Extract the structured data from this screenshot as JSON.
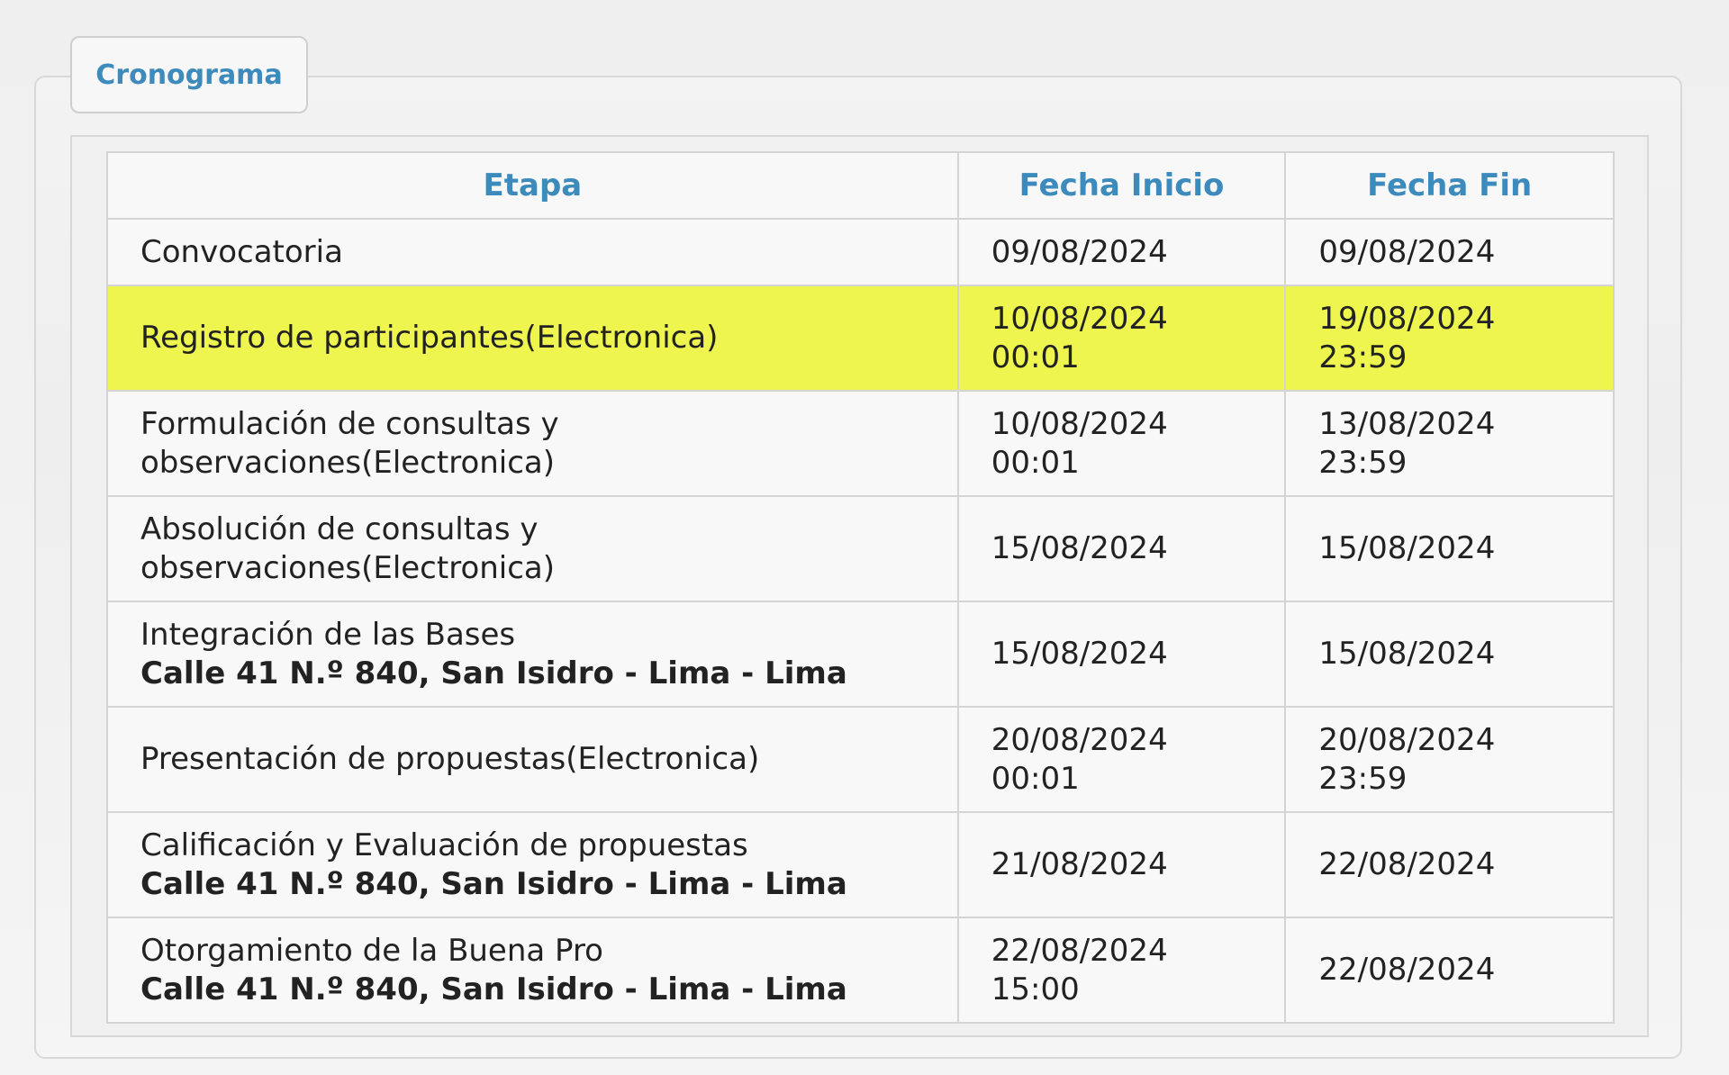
{
  "tab": {
    "label": "Cronograma"
  },
  "table": {
    "headers": {
      "etapa": "Etapa",
      "inicio": "Fecha Inicio",
      "fin": "Fecha Fin"
    },
    "rows": [
      {
        "etapa": "Convocatoria",
        "address": "",
        "inicio_date": "09/08/2024",
        "inicio_time": "",
        "fin_date": "09/08/2024",
        "fin_time": ""
      },
      {
        "etapa": "Registro de participantes(Electronica)",
        "address": "",
        "inicio_date": "10/08/2024",
        "inicio_time": "00:01",
        "fin_date": "19/08/2024",
        "fin_time": "23:59"
      },
      {
        "etapa_l1": "Formulación de consultas y",
        "etapa_l2": "observaciones(Electronica)",
        "inicio_date": "10/08/2024",
        "inicio_time": "00:01",
        "fin_date": "13/08/2024",
        "fin_time": "23:59"
      },
      {
        "etapa_l1": "Absolución de consultas y",
        "etapa_l2": "observaciones(Electronica)",
        "inicio_date": "15/08/2024",
        "inicio_time": "",
        "fin_date": "15/08/2024",
        "fin_time": ""
      },
      {
        "etapa": "Integración de las Bases",
        "address": "Calle 41 N.º 840, San Isidro - Lima - Lima",
        "inicio_date": "15/08/2024",
        "inicio_time": "",
        "fin_date": "15/08/2024",
        "fin_time": ""
      },
      {
        "etapa": "Presentación de propuestas(Electronica)",
        "address": "",
        "inicio_date": "20/08/2024",
        "inicio_time": "00:01",
        "fin_date": "20/08/2024",
        "fin_time": "23:59"
      },
      {
        "etapa": "Calificación y Evaluación de propuestas",
        "address": "Calle 41 N.º 840, San Isidro - Lima - Lima",
        "inicio_date": "21/08/2024",
        "inicio_time": "",
        "fin_date": "22/08/2024",
        "fin_time": ""
      },
      {
        "etapa": "Otorgamiento de la Buena Pro",
        "address": "Calle 41 N.º 840, San Isidro - Lima - Lima",
        "inicio_date": "22/08/2024",
        "inicio_time": "15:00",
        "fin_date": "22/08/2024",
        "fin_time": ""
      }
    ]
  },
  "colors": {
    "accent": "#3d8bbd",
    "highlight": "#eef54e"
  }
}
